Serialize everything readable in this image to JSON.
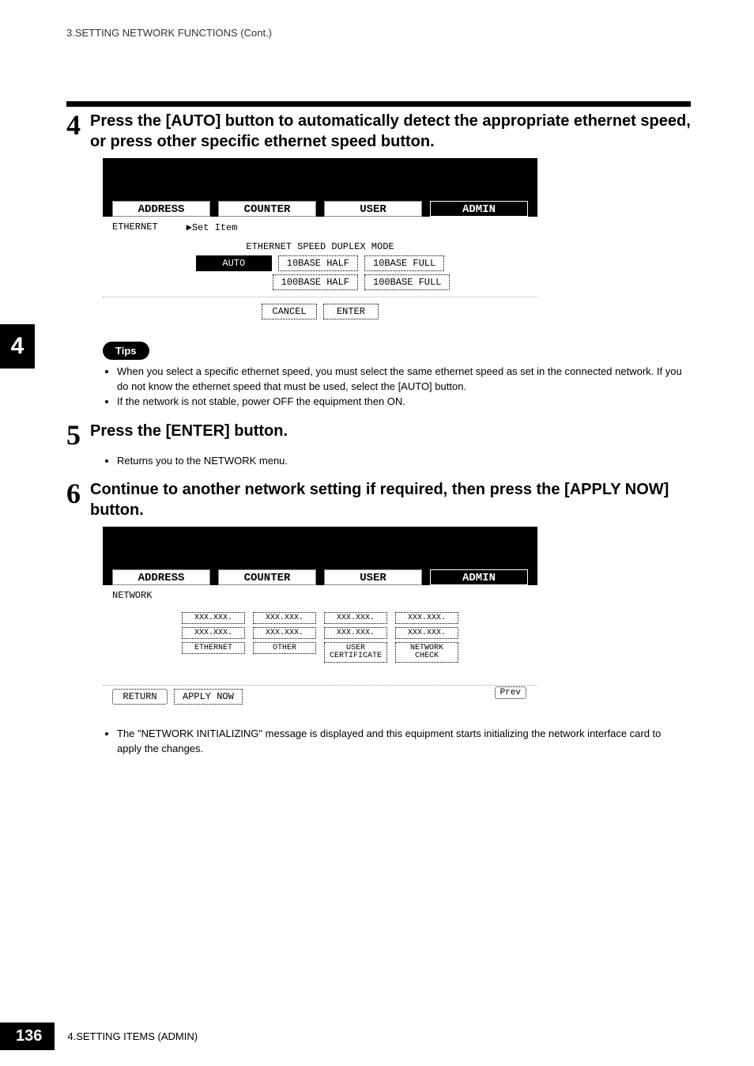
{
  "header": {
    "running": "3.SETTING NETWORK FUNCTIONS (Cont.)"
  },
  "sideTab": "4",
  "steps": {
    "s4": {
      "num": "4",
      "title": "Press the [AUTO] button to automatically detect the appropriate ethernet speed, or press other specific ethernet speed button."
    },
    "s5": {
      "num": "5",
      "title": "Press the [ENTER] button.",
      "note": "Returns you to the NETWORK menu."
    },
    "s6": {
      "num": "6",
      "title": "Continue to another network setting if required, then press the [APPLY NOW] button.",
      "note": "The \"NETWORK INITIALIZING\" message is displayed and this equipment starts initializing the network interface card to apply the changes."
    }
  },
  "tips": {
    "label": "Tips",
    "items": [
      "When you select a specific ethernet speed, you must select the same ethernet speed as set in the connected network.  If you do not know the ethernet speed that must be used, select the [AUTO] button.",
      "If the network is not stable, power OFF the equipment then ON."
    ]
  },
  "screen1": {
    "tabs": {
      "a": "ADDRESS",
      "b": "COUNTER",
      "c": "USER",
      "d": "ADMIN"
    },
    "crumb": "ETHERNET",
    "crumb2": "▶Set Item",
    "modeTitle": "ETHERNET SPEED DUPLEX MODE",
    "btns": {
      "auto": "AUTO",
      "h10": "10BASE HALF",
      "f10": "10BASE FULL",
      "h100": "100BASE HALF",
      "f100": "100BASE FULL",
      "cancel": "CANCEL",
      "enter": "ENTER"
    }
  },
  "screen2": {
    "tabs": {
      "a": "ADDRESS",
      "b": "COUNTER",
      "c": "USER",
      "d": "ADMIN"
    },
    "crumb": "NETWORK",
    "xxx": "XXX.XXX.",
    "ethernet": "ETHERNET",
    "other": "OTHER",
    "usercert": "USER\nCERTIFICATE",
    "netcheck": "NETWORK\nCHECK",
    "return": "RETURN",
    "apply": "APPLY NOW",
    "prev": "Prev"
  },
  "footer": {
    "page": "136",
    "chapter": "4.SETTING ITEMS (ADMIN)"
  }
}
